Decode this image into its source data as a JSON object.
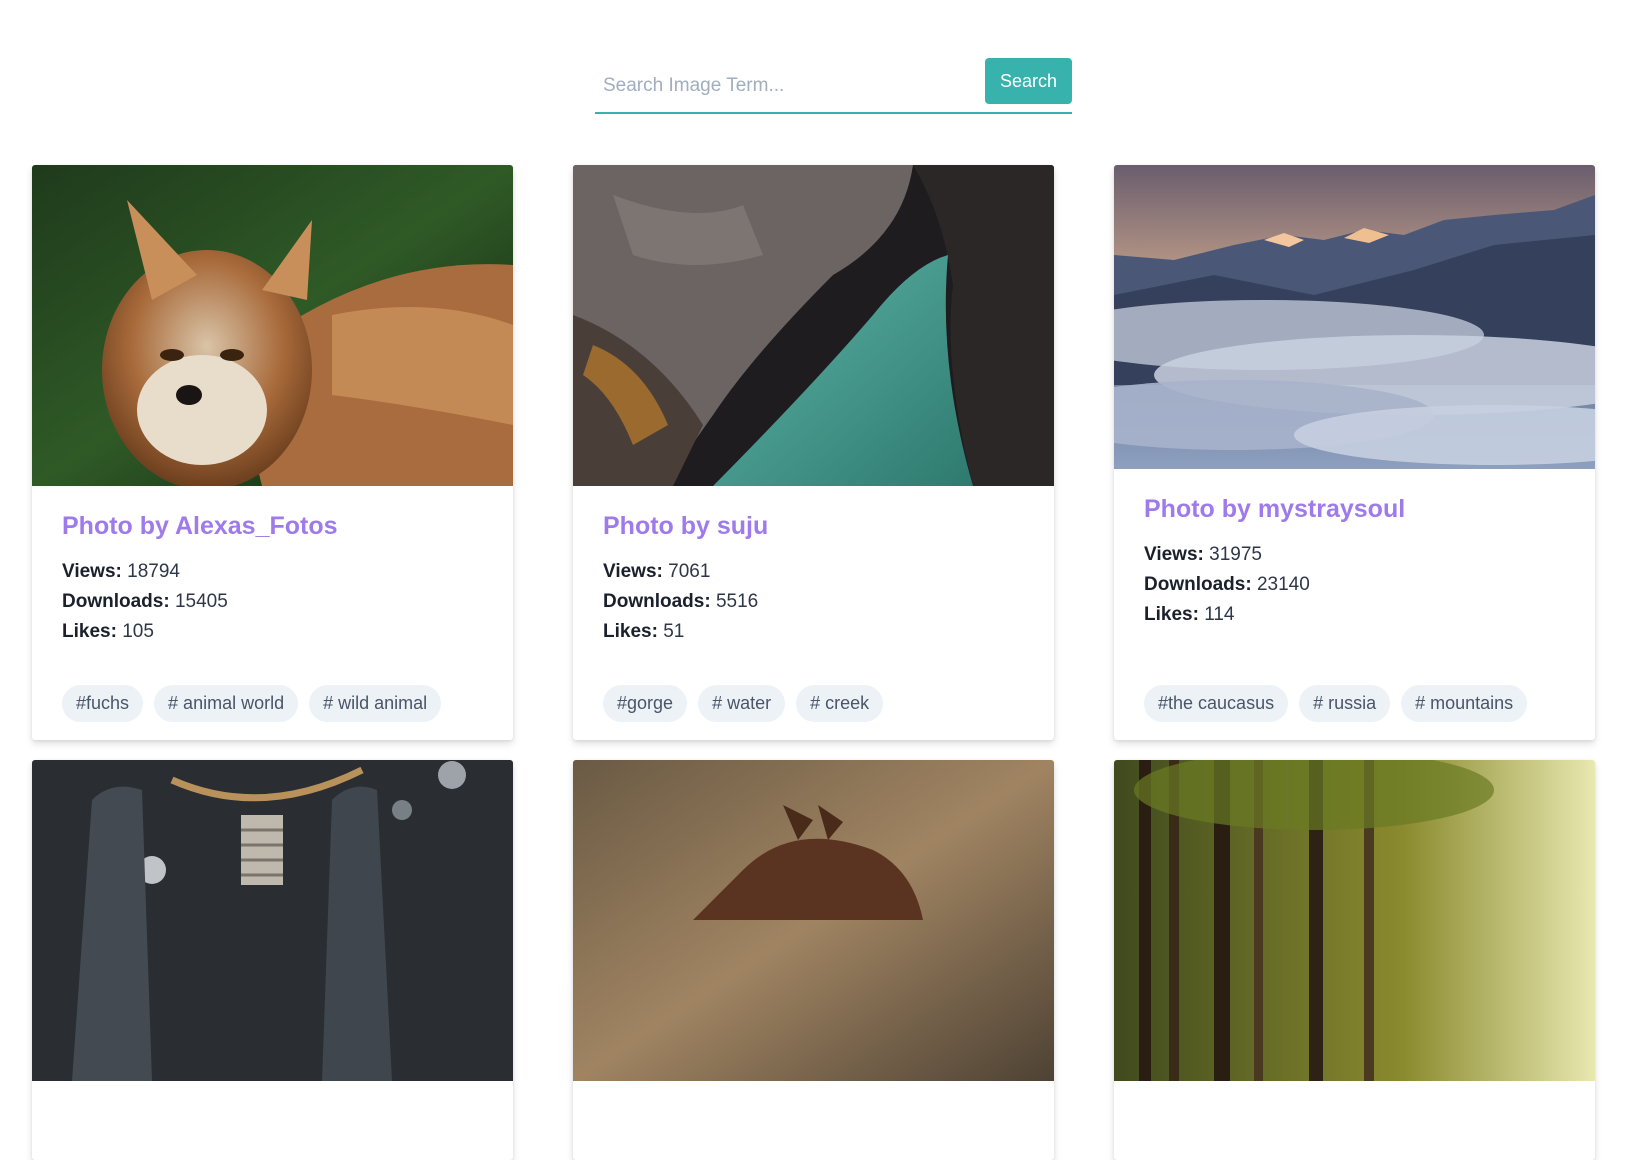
{
  "search": {
    "placeholder": "Search Image Term...",
    "button_label": "Search"
  },
  "cards": [
    {
      "title": "Photo by Alexas_Fotos",
      "views_label": "Views:",
      "views": "18794",
      "downloads_label": "Downloads:",
      "downloads": "15405",
      "likes_label": "Likes:",
      "likes": "105",
      "tags": [
        "#fuchs",
        "# animal world",
        "# wild animal"
      ]
    },
    {
      "title": "Photo by suju",
      "views_label": "Views:",
      "views": "7061",
      "downloads_label": "Downloads:",
      "downloads": "5516",
      "likes_label": "Likes:",
      "likes": "51",
      "tags": [
        "#gorge",
        "# water",
        "# creek"
      ]
    },
    {
      "title": "Photo by mystraysoul",
      "views_label": "Views:",
      "views": "31975",
      "downloads_label": "Downloads:",
      "downloads": "23140",
      "likes_label": "Likes:",
      "likes": "114",
      "tags": [
        "#the caucasus",
        "# russia",
        "# mountains"
      ]
    }
  ],
  "images": [
    "fox-photo",
    "gorge-photo",
    "mountains-photo",
    "lightbulb-photo",
    "horse-photo",
    "forest-photo"
  ]
}
